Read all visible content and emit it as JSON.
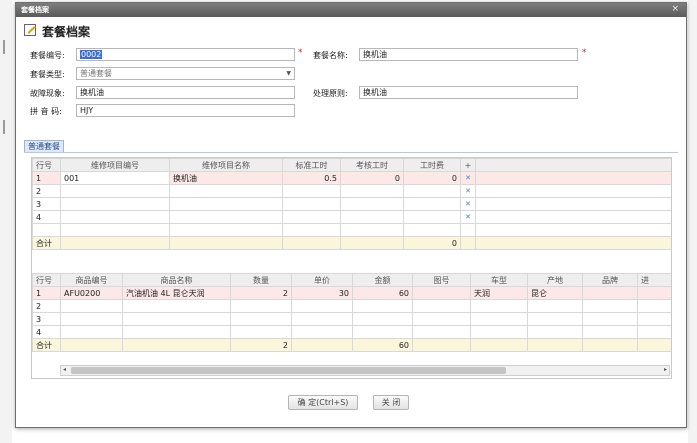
{
  "window": {
    "title": "套餐档案",
    "close_glyph": "×"
  },
  "heading": {
    "icon": "edit-icon",
    "title": "套餐档案"
  },
  "form": {
    "code_label": "套餐编号:",
    "code_value": "0002",
    "name_label": "套餐名称:",
    "name_value": "换机油",
    "type_label": "套餐类型:",
    "type_value": "普通套餐",
    "fault_label": "故障现象:",
    "fault_value": "换机油",
    "rule_label": "处理原则:",
    "rule_value": "换机油",
    "pinyin_label": "拼 音 码:",
    "pinyin_value": "HJY",
    "required_mark": "*"
  },
  "tab": {
    "label": "普通套餐"
  },
  "repair_table": {
    "headers": [
      "行号",
      "维修项目编号",
      "维修项目名称",
      "标准工时",
      "考核工时",
      "工时费",
      "+"
    ],
    "rows": [
      [
        "1",
        "001",
        "换机油",
        "0.5",
        "0",
        "0",
        "✕"
      ],
      [
        "2",
        "",
        "",
        "",
        "",
        "",
        "✕"
      ],
      [
        "3",
        "",
        "",
        "",
        "",
        "",
        "✕"
      ],
      [
        "4",
        "",
        "",
        "",
        "",
        "",
        "✕"
      ]
    ],
    "total": {
      "label": "合计",
      "fee": "0"
    }
  },
  "goods_table": {
    "headers": [
      "行号",
      "商品编号",
      "商品名称",
      "数量",
      "单价",
      "金额",
      "图号",
      "车型",
      "产地",
      "品牌",
      "进"
    ],
    "rows": [
      [
        "1",
        "AFU0200",
        "汽油机油 4L 昆仑天润",
        "2",
        "30",
        "60",
        "",
        "天润",
        "昆仑",
        "",
        ""
      ],
      [
        "2",
        "",
        "",
        "",
        "",
        "",
        "",
        "",
        "",
        "",
        ""
      ],
      [
        "3",
        "",
        "",
        "",
        "",
        "",
        "",
        "",
        "",
        "",
        ""
      ],
      [
        "4",
        "",
        "",
        "",
        "",
        "",
        "",
        "",
        "",
        "",
        ""
      ]
    ],
    "total": {
      "label": "合计",
      "qty": "2",
      "amount": "60"
    }
  },
  "scrollbar": {
    "left_arrow": "◂",
    "right_arrow": "▸"
  },
  "buttons": {
    "confirm": "确 定(Ctrl+S)",
    "close": "关 闭"
  }
}
